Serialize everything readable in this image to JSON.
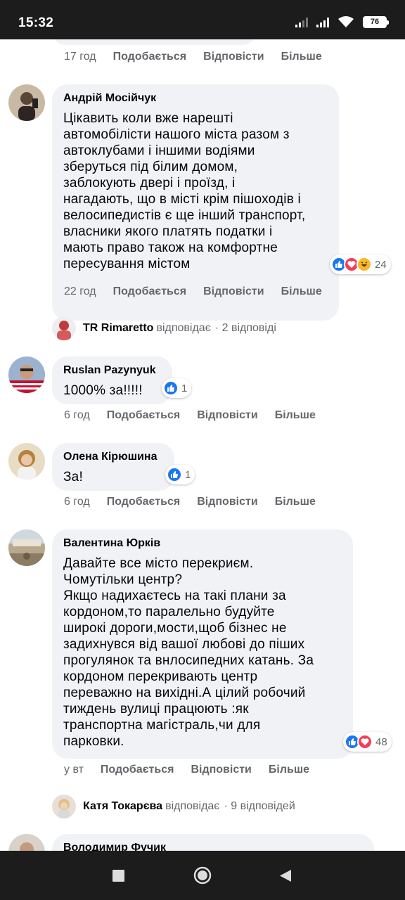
{
  "status_bar": {
    "time": "15:32",
    "battery": "76",
    "icons": [
      "signal-icon",
      "signal-icon",
      "wifi-icon",
      "battery-icon"
    ]
  },
  "actions": {
    "like": "Подобається",
    "reply": "Відповісти",
    "more": "Більше"
  },
  "top_meta": {
    "age": "17 год"
  },
  "comments": [
    {
      "author": "Андрій Мосійчук",
      "text": "Цікавить коли вже нарешті\nавтомобілісти нашого міста разом з\nавтоклубами і іншими водіями\nзберуться під білим домом,\nзаблокують двері і проїзд, і\nнагадають, що в місті крім пішоходів і\nвелосипедистів є ще інший транспорт,\nвласники якого платять податки і\nмають право також на комфортне\nпересування містом",
      "age": "22 год",
      "reactions": [
        "like",
        "love",
        "haha"
      ],
      "reaction_count": "24",
      "reply": {
        "name": "TR Rimaretto",
        "verb": "відповідає",
        "count": "· 2 відповіді"
      }
    },
    {
      "author": "Ruslan Pazynyuk",
      "text": "1000% за!!!!!",
      "age": "6 год",
      "reactions": [
        "like"
      ],
      "reaction_count": "1"
    },
    {
      "author": "Олена Кірюшина",
      "text": "За!",
      "age": "6 год",
      "reactions": [
        "like"
      ],
      "reaction_count": "1"
    },
    {
      "author": "Валентина Юрків",
      "text": "Давайте все місто перекриєм.\nЧомутільки центр?\nЯкщо надихаєтесь на такі плани за\nкордоном,то паралельно будуйте\nширокі дороги,мости,щоб бізнес не\nзадихнувся від вашої любові до піших\nпрогулянок та внлосипедних катань. За\nкордоном перекривають центр\nпереважно на вихідні.А цілий робочий\nтиждень вулиці працюють :як\nтранспортна магістраль,чи для\nпарковки.",
      "age": "у вт",
      "reactions": [
        "like",
        "love"
      ],
      "reaction_count": "48",
      "reply": {
        "name": "Катя Токарєва",
        "verb": "відповідає",
        "count": "· 9 відповідей"
      }
    },
    {
      "author": "Володимир Фучик"
    }
  ]
}
